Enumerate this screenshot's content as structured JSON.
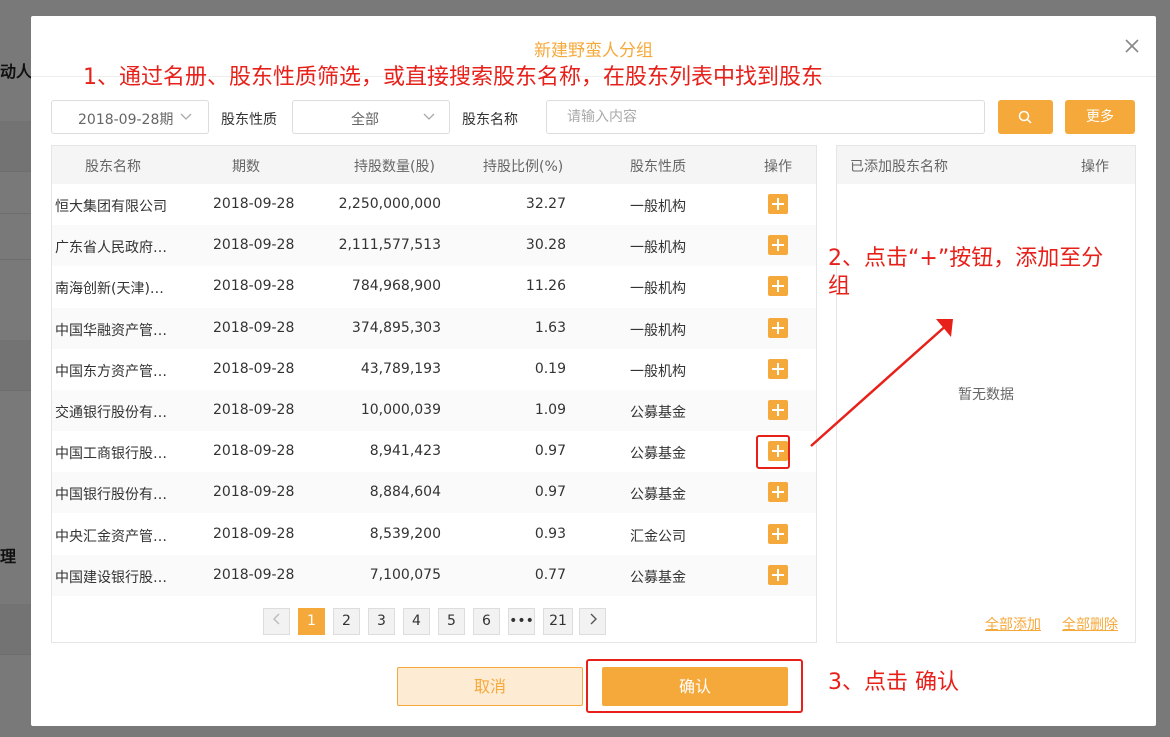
{
  "background": {
    "text_top": "动人",
    "text_bottom": "理"
  },
  "modal": {
    "title": "新建野蛮人分组"
  },
  "annotations": {
    "step1": "1、通过名册、股东性质筛选，或直接搜索股东名称，在股东列表中找到股东",
    "step2_line1": "2、点击“+”按钮，添加至分",
    "step2_line2": "组",
    "step3": "3、点击 确认"
  },
  "filters": {
    "date_value": "2018-09-28期",
    "type_label": "股东性质",
    "type_value": "全部",
    "name_label": "股东名称",
    "search_placeholder": "请输入内容",
    "more_label": "更多"
  },
  "table": {
    "headers": [
      "股东名称",
      "期数",
      "持股数量(股)",
      "持股比例(%)",
      "股东性质",
      "操作"
    ],
    "rows": [
      {
        "name": "恒大集团有限公司",
        "period": "2018-09-28",
        "shares": "2,250,000,000",
        "ratio": "32.27",
        "type": "一般机构"
      },
      {
        "name": "广东省人民政府…",
        "period": "2018-09-28",
        "shares": "2,111,577,513",
        "ratio": "30.28",
        "type": "一般机构"
      },
      {
        "name": "南海创新(天津)…",
        "period": "2018-09-28",
        "shares": "784,968,900",
        "ratio": "11.26",
        "type": "一般机构"
      },
      {
        "name": "中国华融资产管…",
        "period": "2018-09-28",
        "shares": "374,895,303",
        "ratio": "1.63",
        "type": "一般机构"
      },
      {
        "name": "中国东方资产管…",
        "period": "2018-09-28",
        "shares": "43,789,193",
        "ratio": "0.19",
        "type": "一般机构"
      },
      {
        "name": "交通银行股份有…",
        "period": "2018-09-28",
        "shares": "10,000,039",
        "ratio": "1.09",
        "type": "公募基金"
      },
      {
        "name": "中国工商银行股…",
        "period": "2018-09-28",
        "shares": "8,941,423",
        "ratio": "0.97",
        "type": "公募基金"
      },
      {
        "name": "中国银行股份有…",
        "period": "2018-09-28",
        "shares": "8,884,604",
        "ratio": "0.97",
        "type": "公募基金"
      },
      {
        "name": "中央汇金资产管…",
        "period": "2018-09-28",
        "shares": "8,539,200",
        "ratio": "0.93",
        "type": "汇金公司"
      },
      {
        "name": "中国建设银行股…",
        "period": "2018-09-28",
        "shares": "7,100,075",
        "ratio": "0.77",
        "type": "公募基金"
      }
    ]
  },
  "pagination": {
    "pages": [
      "1",
      "2",
      "3",
      "4",
      "5",
      "6",
      "•••",
      "21"
    ],
    "current": "1"
  },
  "selected": {
    "header_name": "已添加股东名称",
    "header_action": "操作",
    "empty_text": "暂无数据",
    "add_all": "全部添加",
    "delete_all": "全部删除"
  },
  "footer": {
    "cancel": "取消",
    "confirm": "确认"
  },
  "colors": {
    "accent": "#f6a93b",
    "annotation": "#e8201a"
  }
}
